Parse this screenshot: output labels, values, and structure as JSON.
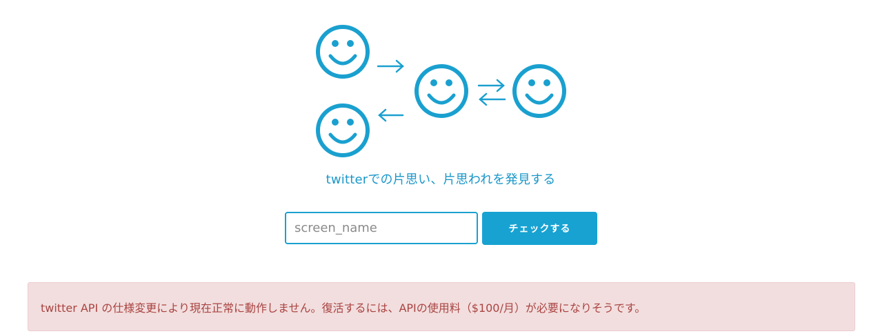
{
  "tagline": "twitterでの片思い、片思われを発見する",
  "form": {
    "placeholder": "screen_name",
    "value": "",
    "check_button_label": "チェックする"
  },
  "alert": {
    "message": "twitter API の仕様変更により現在正常に動作しません。復活するには、APIの使用料（$100/月）が必要になりそうです。"
  },
  "colors": {
    "accent": "#17a2d2",
    "alert_background": "#f2dede",
    "alert_text": "#a94442"
  },
  "icons": [
    "smiley-face-icon",
    "arrow-right-icon",
    "arrow-left-icon",
    "exchange-arrows-icon"
  ]
}
